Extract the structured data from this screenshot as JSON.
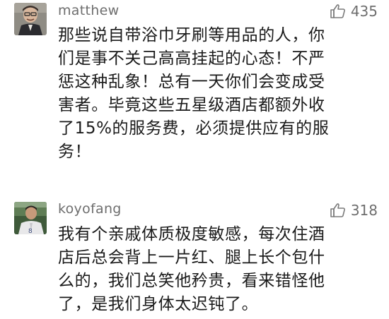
{
  "comments": [
    {
      "username": "matthew",
      "likes": "435",
      "avatar_icon": "user-avatar-icon",
      "lines": [
        "那些说自带浴巾牙刷等用品的人，你",
        "们是事不关己高高挂起的心态！不严",
        "惩这种乱象！总有一天你们会变成受",
        "害者。毕竟这些五星级酒店都额外收",
        "了15%的服务费，必须提供应有的服",
        "务！"
      ]
    },
    {
      "username": "koyofang",
      "likes": "318",
      "avatar_icon": "user-avatar-icon",
      "lines": [
        "我有个亲戚体质极度敏感，每次住酒",
        "店后总会背上一片红、腿上长个包什",
        "么的，我们总笑他矜贵，看来错怪他",
        "了，是我们身体太迟钝了。"
      ]
    }
  ],
  "like_icon": "thumbs-up-icon",
  "colors": {
    "username": "#6e6e6e",
    "text": "#1a1a1a",
    "like": "#6e6e6e",
    "background": "#ffffff"
  }
}
